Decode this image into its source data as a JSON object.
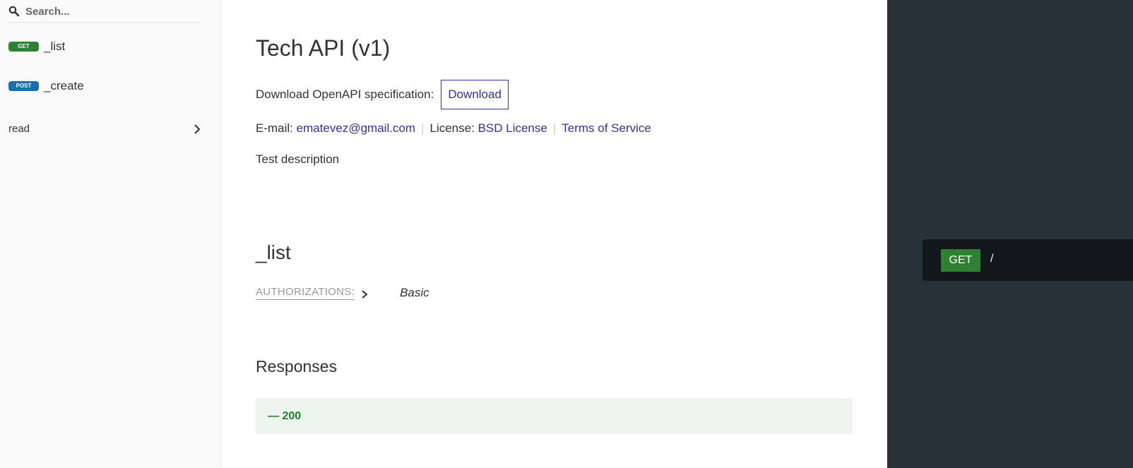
{
  "sidebar": {
    "search_placeholder": "Search...",
    "items": [
      {
        "method": "GET",
        "label": "_list",
        "color": "#2f8132"
      },
      {
        "method": "POST",
        "label": "_create",
        "color": "#186fb0"
      }
    ],
    "group": {
      "label": "read"
    }
  },
  "main": {
    "title": "Tech API (v1)",
    "download_text": "Download OpenAPI specification:",
    "download_button": "Download",
    "email_label": "E-mail:",
    "email": "ematevez@gmail.com",
    "separator": "|",
    "license_label": "License:",
    "license": "BSD License",
    "terms": "Terms of Service",
    "description": "Test description",
    "operation_title": "_list",
    "authorizations_label": "AUTHORIZATIONS:",
    "authorization_value": "Basic",
    "responses_title": "Responses",
    "response_code": "— 200"
  },
  "right_panel": {
    "method": "GET",
    "path": "/"
  },
  "colors": {
    "accent": "#32329f",
    "get": "#2f8132",
    "post": "#186fb0",
    "right_bg": "#263238",
    "response_success_bg": "#edf5ee"
  }
}
